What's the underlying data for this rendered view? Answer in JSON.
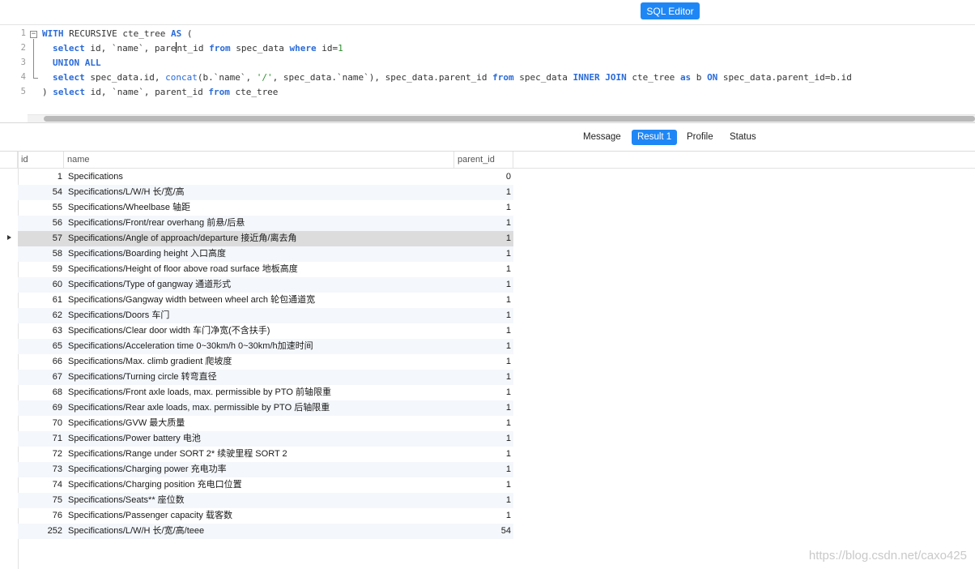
{
  "toolbar": {
    "sql_editor_label": "SQL Editor"
  },
  "editor": {
    "line_numbers": [
      "1",
      "2",
      "3",
      "4",
      "5"
    ],
    "fold_symbol": "−"
  },
  "tabs": [
    {
      "label": "Message",
      "active": false
    },
    {
      "label": "Result 1",
      "active": true
    },
    {
      "label": "Profile",
      "active": false
    },
    {
      "label": "Status",
      "active": false
    }
  ],
  "grid": {
    "columns": [
      "id",
      "name",
      "parent_id"
    ],
    "selected_row_index": 4,
    "rows": [
      {
        "id": "1",
        "name": "Specifications",
        "parent_id": "0"
      },
      {
        "id": "54",
        "name": "Specifications/L/W/H 长/宽/高",
        "parent_id": "1"
      },
      {
        "id": "55",
        "name": "Specifications/Wheelbase 轴距",
        "parent_id": "1"
      },
      {
        "id": "56",
        "name": "Specifications/Front/rear overhang 前悬/后悬",
        "parent_id": "1"
      },
      {
        "id": "57",
        "name": "Specifications/Angle of approach/departure 接近角/离去角",
        "parent_id": "1"
      },
      {
        "id": "58",
        "name": "Specifications/Boarding height 入口高度",
        "parent_id": "1"
      },
      {
        "id": "59",
        "name": "Specifications/Height of floor above road surface 地板高度",
        "parent_id": "1"
      },
      {
        "id": "60",
        "name": "Specifications/Type of gangway 通道形式",
        "parent_id": "1"
      },
      {
        "id": "61",
        "name": "Specifications/Gangway width between wheel arch 轮包通道宽",
        "parent_id": "1"
      },
      {
        "id": "62",
        "name": "Specifications/Doors 车门",
        "parent_id": "1"
      },
      {
        "id": "63",
        "name": "Specifications/Clear door width 车门净宽(不含扶手)",
        "parent_id": "1"
      },
      {
        "id": "65",
        "name": "Specifications/Acceleration time 0~30km/h 0~30km/h加速时间",
        "parent_id": "1"
      },
      {
        "id": "66",
        "name": "Specifications/Max. climb gradient 爬坡度",
        "parent_id": "1"
      },
      {
        "id": "67",
        "name": "Specifications/Turning circle 转弯直径",
        "parent_id": "1"
      },
      {
        "id": "68",
        "name": "Specifications/Front axle loads, max. permissible by PTO 前轴限重",
        "parent_id": "1"
      },
      {
        "id": "69",
        "name": "Specifications/Rear axle loads, max. permissible by PTO 后轴限重",
        "parent_id": "1"
      },
      {
        "id": "70",
        "name": "Specifications/GVW 最大质量",
        "parent_id": "1"
      },
      {
        "id": "71",
        "name": "Specifications/Power battery 电池",
        "parent_id": "1"
      },
      {
        "id": "72",
        "name": "Specifications/Range under SORT 2* 续驶里程 SORT 2",
        "parent_id": "1"
      },
      {
        "id": "73",
        "name": "Specifications/Charging power 充电功率",
        "parent_id": "1"
      },
      {
        "id": "74",
        "name": "Specifications/Charging position 充电口位置",
        "parent_id": "1"
      },
      {
        "id": "75",
        "name": "Specifications/Seats** 座位数",
        "parent_id": "1"
      },
      {
        "id": "76",
        "name": "Specifications/Passenger capacity 载客数",
        "parent_id": "1"
      },
      {
        "id": "252",
        "name": "Specifications/L/W/H 长/宽/高/teee",
        "parent_id": "54"
      }
    ]
  },
  "sql": {
    "l1_kw1": "WITH",
    "l1_t1": " RECURSIVE cte_tree ",
    "l1_kw2": "AS",
    "l1_t2": " (",
    "l2_kw1": "select",
    "l2_t1": " id, `name`, pare",
    "l2_t2": "nt_id ",
    "l2_kw2": "from",
    "l2_t3": " spec_data ",
    "l2_kw3": "where",
    "l2_t4": " id=",
    "l2_num": "1",
    "l3_kw1": "UNION ALL",
    "l4_kw1": "select",
    "l4_t1": " spec_data.id, ",
    "l4_fn": "concat",
    "l4_t2": "(b.`name`, ",
    "l4_str": "'/'",
    "l4_t3": ", spec_data.`name`), spec_data.parent_id ",
    "l4_kw2": "from",
    "l4_t4": " spec_data ",
    "l4_kw3": "INNER JOIN",
    "l4_t5": " cte_tree ",
    "l4_kw4": "as",
    "l4_t6": " b ",
    "l4_kw5": "ON",
    "l4_t7": " spec_data.parent_id=b.id",
    "l5_t1": ") ",
    "l5_kw1": "select",
    "l5_t2": " id, `name`, parent_id ",
    "l5_kw2": "from",
    "l5_t3": " cte_tree"
  },
  "watermark": "https://blog.csdn.net/caxo425",
  "colors": {
    "accent": "#1f87f5",
    "keyword": "#2a6bd8",
    "literal": "#2f8f2f",
    "selected_row": "#dcdcdc",
    "alt_row": "#f4f7fb"
  }
}
